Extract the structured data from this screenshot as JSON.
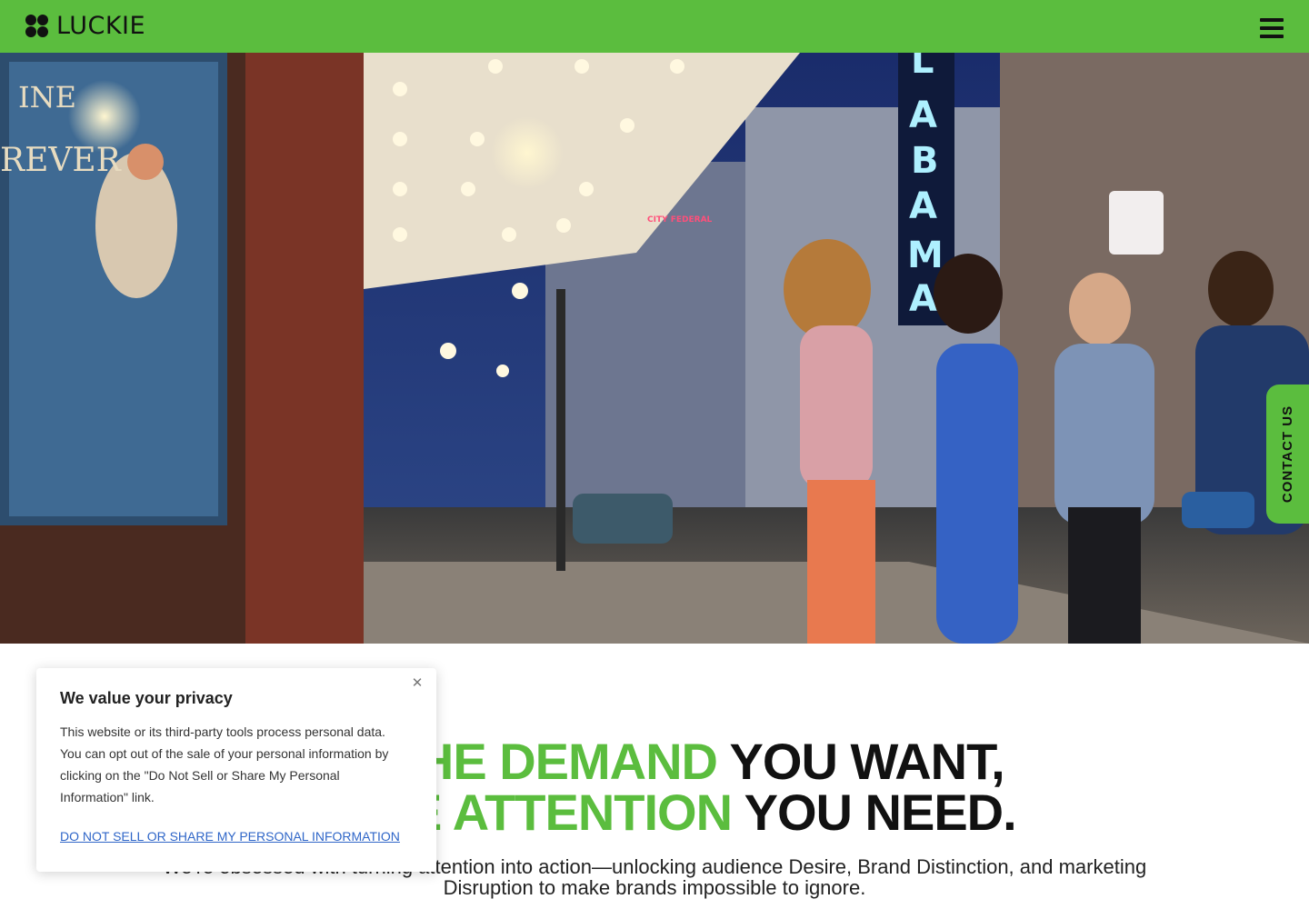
{
  "header": {
    "logo_text": "LUCKIE",
    "menu_icon": "hamburger-menu-icon"
  },
  "hero": {
    "sign_letters": [
      "L",
      "A",
      "B",
      "A",
      "M",
      "A"
    ],
    "small_sign": "CITY FEDERAL",
    "poster_text": [
      "INE",
      "REVER"
    ]
  },
  "contact_tab": {
    "label": "CONTACT US"
  },
  "headline": {
    "line1_green": "ER THE DEMAND",
    "line1_black": "YOU WANT,",
    "line2_green": "R THE ATTENTION",
    "line2_black": "YOU NEED."
  },
  "subcopy": "We're obsessed with turning attention into action—unlocking audience Desire, Brand Distinction, and marketing Disruption to make brands impossible to ignore.",
  "privacy": {
    "title": "We value your privacy",
    "body": "This website or its third-party tools process personal data. You can opt out of the sale of your personal information by clicking on the \"Do Not Sell or Share My Personal Information\" link.",
    "link_label": "DO NOT SELL OR SHARE MY PERSONAL INFORMATION",
    "close_icon": "close-icon"
  },
  "colors": {
    "brand_green": "#5bbd3e",
    "text_dark": "#111111",
    "link_blue": "#2f66c8"
  }
}
